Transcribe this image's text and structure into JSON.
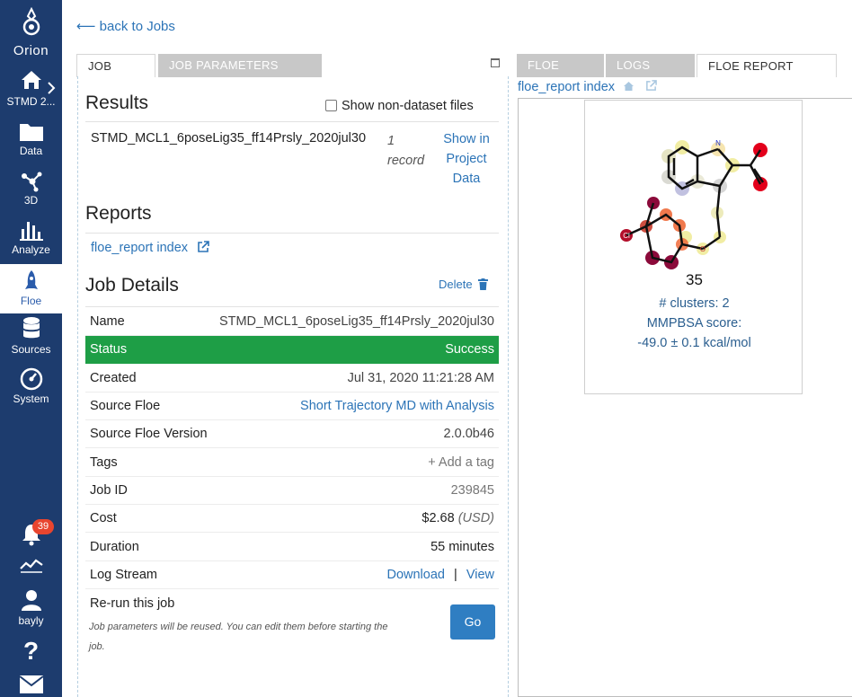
{
  "sidebar": {
    "logo_label": "Orion",
    "project_label": "STMD 2...",
    "items": [
      {
        "label": "Data",
        "icon": "folder-icon"
      },
      {
        "label": "3D",
        "icon": "molecule-3d-icon"
      },
      {
        "label": "Analyze",
        "icon": "bar-chart-icon"
      },
      {
        "label": "Floe",
        "icon": "rocket-icon"
      },
      {
        "label": "Sources",
        "icon": "database-icon"
      },
      {
        "label": "System",
        "icon": "gauge-icon"
      }
    ],
    "notification_count": "39",
    "user_label": "bayly",
    "colors": {
      "background": "#1d3c6e",
      "active_text": "#2b5cab",
      "badge": "#e8452f"
    }
  },
  "nav": {
    "back_label": "⟵ back to Jobs"
  },
  "left_tabs": [
    "JOB",
    "JOB PARAMETERS"
  ],
  "right_tabs": [
    "FLOE",
    "LOGS",
    "FLOE REPORT"
  ],
  "results": {
    "heading": "Results",
    "show_nondataset_label": "Show non-dataset files",
    "dataset_name": "STMD_MCL1_6poseLig35_ff14Prsly_2020jul30",
    "record_count_line1": "1",
    "record_count_line2": "record",
    "show_in_line1": "Show in",
    "show_in_line2": "Project",
    "show_in_line3": "Data"
  },
  "reports": {
    "heading": "Reports",
    "link_label": "floe_report index"
  },
  "job_details": {
    "heading": "Job Details",
    "delete_label": "Delete",
    "rows": [
      {
        "key": "Name",
        "value": "STMD_MCL1_6poseLig35_ff14Prsly_2020jul30"
      },
      {
        "key": "Status",
        "value": "Success"
      },
      {
        "key": "Created",
        "value": "Jul 31, 2020 11:21:28 AM"
      },
      {
        "key": "Source Floe",
        "value": "Short Trajectory MD with Analysis"
      },
      {
        "key": "Source Floe Version",
        "value": "2.0.0b46"
      },
      {
        "key": "Tags",
        "value": "+ Add a tag"
      },
      {
        "key": "Job ID",
        "value": "239845"
      },
      {
        "key": "Cost",
        "value": "$2.68",
        "unit": "(USD)"
      },
      {
        "key": "Duration",
        "value": "55 minutes"
      },
      {
        "key": "Log Stream",
        "download": "Download",
        "separator": "|",
        "view": "View"
      }
    ],
    "rerun_label": "Re-run this job",
    "rerun_note_line1": "Job parameters will be reused. You can edit them before starting the",
    "rerun_note_line2": "job.",
    "go_label": "Go",
    "status_color": "#1e9e46"
  },
  "floe_report": {
    "breadcrumb_label": "floe_report index",
    "ligand_id": "35",
    "clusters_label": "# clusters: 2",
    "score_label": "MMPBSA score:",
    "score_value": "-49.0 ± 0.1 kcal/mol",
    "atom_labels": {
      "nh": "H\nN",
      "cl": "Cl",
      "o": "O"
    }
  }
}
